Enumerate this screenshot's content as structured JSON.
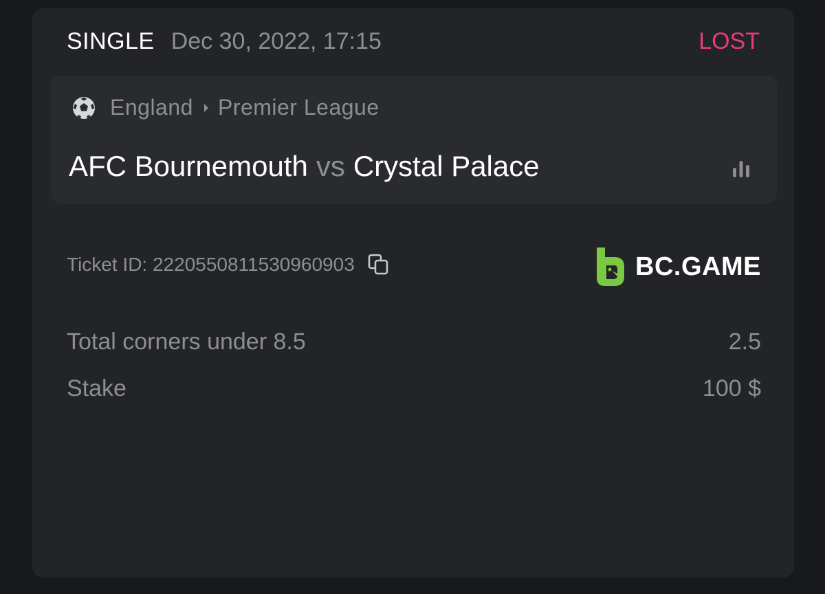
{
  "bet": {
    "type": "SINGLE",
    "date": "Dec 30, 2022, 17:15",
    "status": "LOST",
    "status_color": "#e83c77"
  },
  "match": {
    "sport_icon": "soccer-ball-icon",
    "country": "England",
    "league": "Premier League",
    "home_team": "AFC Bournemouth",
    "vs": "vs",
    "away_team": "Crystal Palace",
    "stats_icon": "bar-chart-icon"
  },
  "ticket": {
    "label": "Ticket ID: 2220550811530960903",
    "copy_icon": "copy-icon"
  },
  "brand": {
    "name": "BC.GAME",
    "logo_color": "#7ac943"
  },
  "details": {
    "market_label": "Total corners under 8.5",
    "market_odds": "2.5",
    "stake_label": "Stake",
    "stake_value": "100 $"
  }
}
